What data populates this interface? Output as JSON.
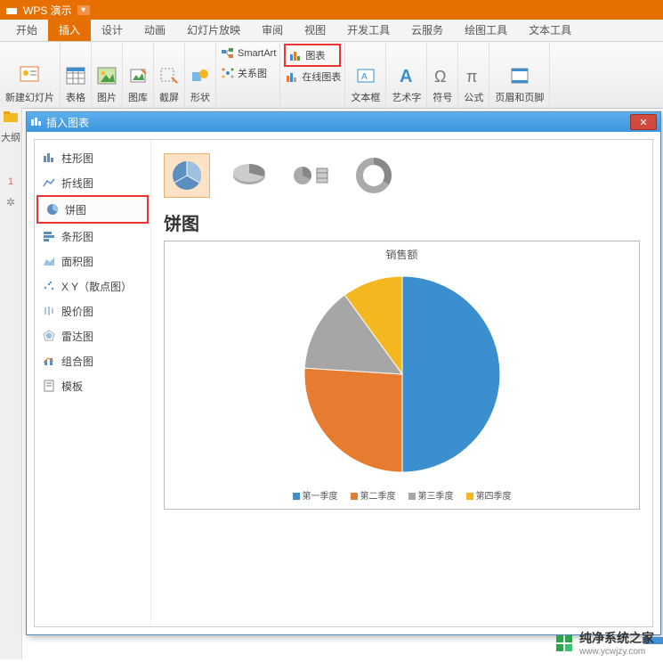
{
  "app": {
    "title": "WPS 演示"
  },
  "menus": {
    "items": [
      "开始",
      "插入",
      "设计",
      "动画",
      "幻灯片放映",
      "审阅",
      "视图",
      "开发工具",
      "云服务",
      "绘图工具",
      "文本工具"
    ],
    "active_index": 1
  },
  "ribbon": {
    "new_slide": "新建幻灯片",
    "table": "表格",
    "picture": "图片",
    "gallery": "图库",
    "screenshot": "截屏",
    "shapes": "形状",
    "smartart": "SmartArt",
    "relation": "关系图",
    "chart": "图表",
    "online_chart": "在线图表",
    "textbox": "文本框",
    "wordart": "艺术字",
    "symbol": "符号",
    "equation": "公式",
    "header_footer": "页眉和页脚"
  },
  "sidebar": {
    "outline_label": "大纲",
    "slide_number": "1",
    "anim_marker": "✲"
  },
  "dialog": {
    "title": "插入图表",
    "categories": [
      "柱形图",
      "折线图",
      "饼图",
      "条形图",
      "面积图",
      "X Y（散点图）",
      "股价图",
      "雷达图",
      "组合图",
      "模板"
    ],
    "selected_category_index": 2,
    "section_title": "饼图",
    "preview_title": "销售额",
    "legend": [
      "第一季度",
      "第二季度",
      "第三季度",
      "第四季度"
    ]
  },
  "chart_data": {
    "type": "pie",
    "title": "销售额",
    "series": [
      {
        "name": "第一季度",
        "value": 50,
        "color": "#3c8fcf"
      },
      {
        "name": "第二季度",
        "value": 26,
        "color": "#e77c30"
      },
      {
        "name": "第三季度",
        "value": 14,
        "color": "#a6a6a6"
      },
      {
        "name": "第四季度",
        "value": 10,
        "color": "#f3b71f"
      }
    ]
  },
  "watermark": {
    "brand": "纯净系统之家",
    "url": "www.ycwjzy.com"
  }
}
